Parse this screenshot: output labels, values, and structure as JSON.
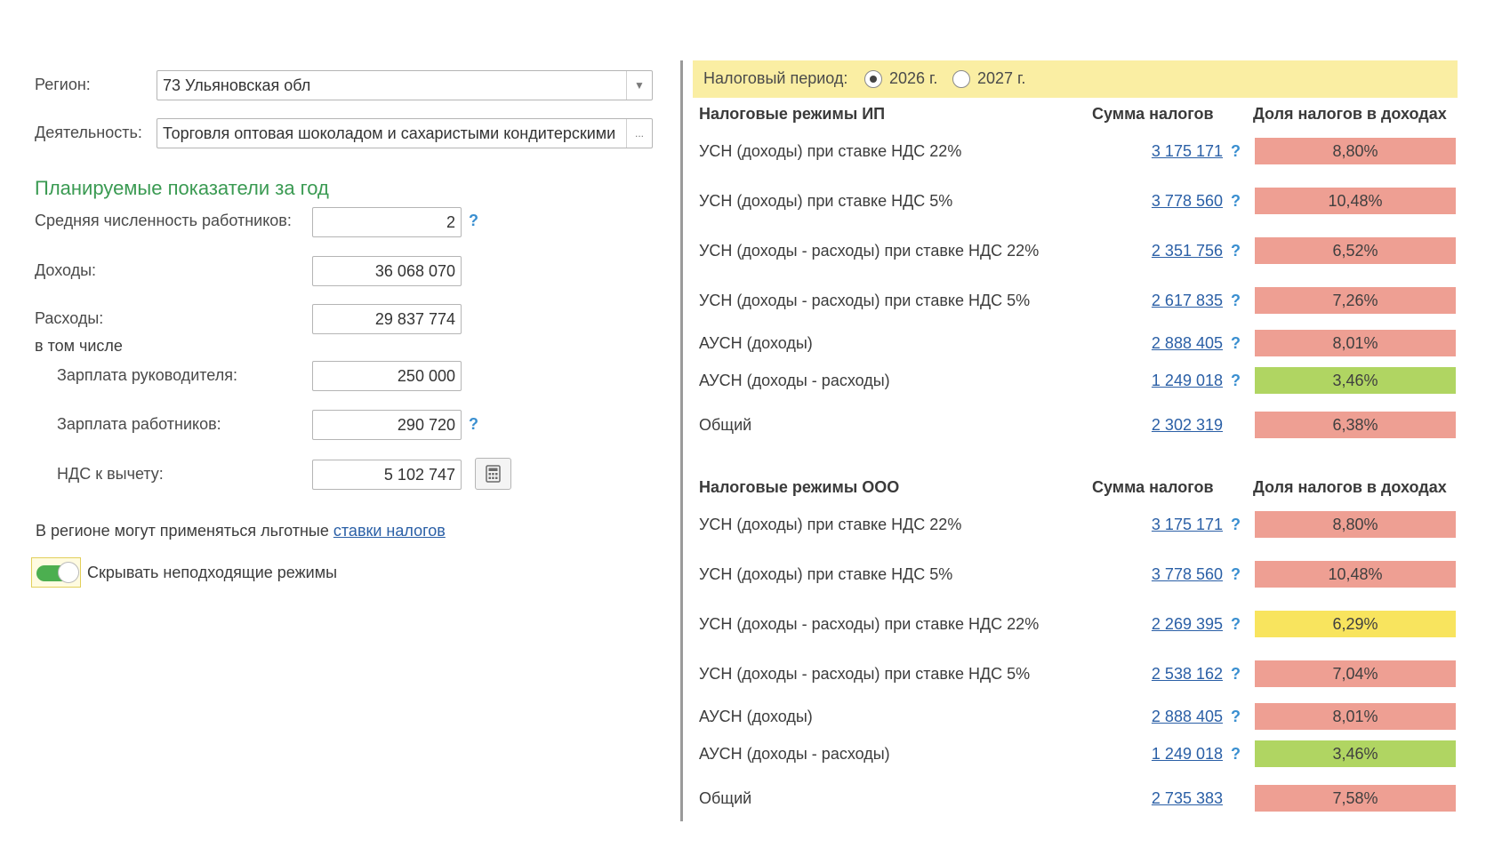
{
  "left": {
    "region_label": "Регион:",
    "region_value": "73 Ульяновская обл",
    "activity_label": "Деятельность:",
    "activity_value": "Торговля оптовая шоколадом и сахаристыми кондитерскими",
    "activity_button": "...",
    "section_title": "Планируемые показатели за год",
    "employees_label": "Средняя численность работников:",
    "employees_value": "2",
    "income_label": "Доходы:",
    "income_value": "36 068 070",
    "expenses_label": "Расходы:",
    "including_label": "в том числе",
    "director_salary_label": "Зарплата руководителя:",
    "director_salary_value": "250 000",
    "workers_salary_label": "Зарплата работников:",
    "workers_salary_value": "290 720",
    "vat_label": "НДС к вычету:",
    "vat_value": "5 102 747",
    "help_mark": "?",
    "expenses_value": "29 837 774",
    "region_note": "В регионе могут применяться льготные",
    "region_note_link": "ставки налогов",
    "hide_toggle_label": "Скрывать неподходящие режимы",
    "hide_toggle_on": true
  },
  "right": {
    "period_label": "Налоговый период:",
    "period_options": [
      "2026 г.",
      "2027 г."
    ],
    "period_selected": "2026 г.",
    "ip": {
      "title": "Налоговые режимы ИП",
      "col_sum": "Сумма налогов",
      "col_share": "Доля налогов в доходах",
      "rows": [
        {
          "name": "УСН (доходы) при ставке НДС 22%",
          "amount": "3 175 171",
          "help": "?",
          "share": "8,80%",
          "color": "red"
        },
        {
          "name": "УСН (доходы) при ставке НДС 5%",
          "amount": "3 778 560",
          "help": "?",
          "share": "10,48%",
          "color": "red"
        },
        {
          "name": "УСН (доходы - расходы) при ставке НДС 22%",
          "amount": "2 351 756",
          "help": "?",
          "share": "6,52%",
          "color": "red"
        },
        {
          "name": "УСН (доходы - расходы) при ставке НДС 5%",
          "amount": "2 617 835",
          "help": "?",
          "share": "7,26%",
          "color": "red"
        },
        {
          "name": "АУСН (доходы)",
          "amount": "2 888 405",
          "help": "?",
          "share": "8,01%",
          "color": "red"
        },
        {
          "name": "АУСН (доходы - расходы)",
          "amount": "1 249 018",
          "help": "?",
          "share": "3,46%",
          "color": "green"
        },
        {
          "name": "Общий",
          "amount": "2 302 319",
          "help": "",
          "share": "6,38%",
          "color": "red"
        }
      ]
    },
    "ooo": {
      "title": "Налоговые режимы ООО",
      "col_sum": "Сумма налогов",
      "col_share": "Доля налогов в доходах",
      "rows": [
        {
          "name": "УСН (доходы) при ставке НДС 22%",
          "amount": "3 175 171",
          "help": "?",
          "share": "8,80%",
          "color": "red"
        },
        {
          "name": "УСН (доходы) при ставке НДС 5%",
          "amount": "3 778 560",
          "help": "?",
          "share": "10,48%",
          "color": "red"
        },
        {
          "name": "УСН (доходы - расходы) при ставке НДС 22%",
          "amount": "2 269 395",
          "help": "?",
          "share": "6,29%",
          "color": "yellow"
        },
        {
          "name": "УСН (доходы - расходы) при ставке НДС 5%",
          "amount": "2 538 162",
          "help": "?",
          "share": "7,04%",
          "color": "red"
        },
        {
          "name": "АУСН (доходы)",
          "amount": "2 888 405",
          "help": "?",
          "share": "8,01%",
          "color": "red"
        },
        {
          "name": "АУСН (доходы - расходы)",
          "amount": "1 249 018",
          "help": "?",
          "share": "3,46%",
          "color": "green"
        },
        {
          "name": "Общий",
          "amount": "2 735 383",
          "help": "",
          "share": "7,58%",
          "color": "red"
        }
      ]
    },
    "colors": {
      "red": "#ee9f93",
      "green": "#b0d562",
      "yellow": "#f8e45e",
      "highlight": "#faeea3"
    }
  }
}
